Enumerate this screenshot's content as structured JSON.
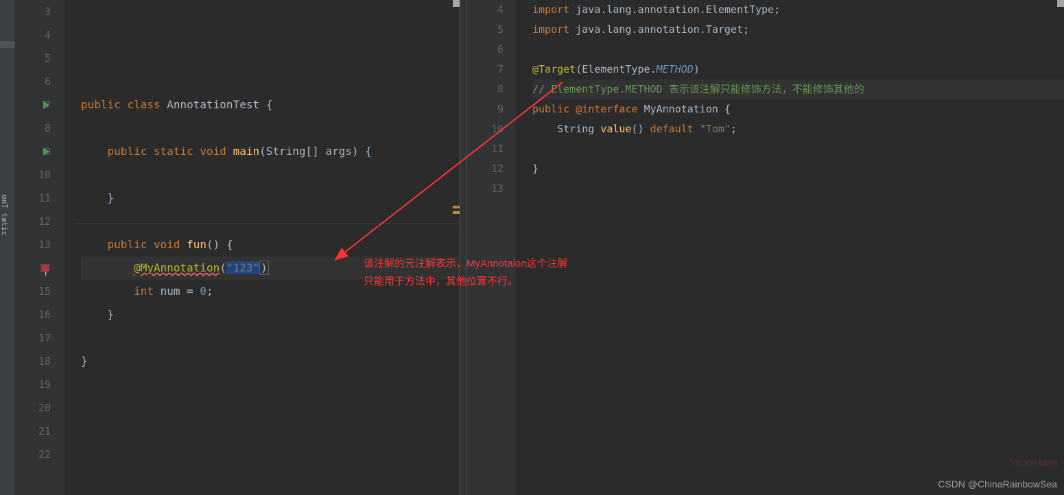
{
  "leftTab": {
    "label": "onT\ntatic"
  },
  "leftPane": {
    "startLine": 3,
    "lines": [
      {
        "n": 3,
        "indent": 0,
        "tokens": []
      },
      {
        "n": 4,
        "indent": 0,
        "tokens": []
      },
      {
        "n": 5,
        "indent": 0,
        "tokens": []
      },
      {
        "n": 6,
        "indent": 0,
        "tokens": []
      },
      {
        "n": 7,
        "indent": 0,
        "run": true,
        "tokens": [
          {
            "t": "public ",
            "c": "kw"
          },
          {
            "t": "class ",
            "c": "kw"
          },
          {
            "t": "AnnotationTest ",
            "c": "cls"
          },
          {
            "t": "{",
            "c": ""
          }
        ]
      },
      {
        "n": 8,
        "indent": 0,
        "tokens": []
      },
      {
        "n": 9,
        "indent": 1,
        "run": true,
        "tokens": [
          {
            "t": "public ",
            "c": "kw"
          },
          {
            "t": "static ",
            "c": "kw"
          },
          {
            "t": "void ",
            "c": "kw"
          },
          {
            "t": "main",
            "c": "method"
          },
          {
            "t": "(",
            "c": ""
          },
          {
            "t": "String",
            "c": "cls"
          },
          {
            "t": "[] ",
            "c": ""
          },
          {
            "t": "args",
            "c": "cls"
          },
          {
            "t": ") {",
            "c": ""
          }
        ]
      },
      {
        "n": 10,
        "indent": 0,
        "tokens": []
      },
      {
        "n": 11,
        "indent": 1,
        "tokens": [
          {
            "t": "}",
            "c": ""
          }
        ]
      },
      {
        "n": 12,
        "indent": 0,
        "tokens": [],
        "sep": true
      },
      {
        "n": 13,
        "indent": 1,
        "tokens": [
          {
            "t": "public ",
            "c": "kw"
          },
          {
            "t": "void ",
            "c": "kw"
          },
          {
            "t": "fun",
            "c": "method"
          },
          {
            "t": "() {",
            "c": ""
          }
        ]
      },
      {
        "n": 14,
        "indent": 2,
        "cursor": true,
        "error": true,
        "tokens": [
          {
            "t": "@MyAnnotation",
            "c": "ann error-underline"
          },
          {
            "t": "(",
            "c": ""
          },
          {
            "t": "\"123\"",
            "c": "str selection"
          },
          {
            "t": ")",
            "c": "caret-border"
          }
        ]
      },
      {
        "n": 15,
        "indent": 2,
        "tokens": [
          {
            "t": "int ",
            "c": "kw"
          },
          {
            "t": "num = ",
            "c": "cls"
          },
          {
            "t": "0",
            "c": "num"
          },
          {
            "t": ";",
            "c": ""
          }
        ]
      },
      {
        "n": 16,
        "indent": 1,
        "tokens": [
          {
            "t": "}",
            "c": ""
          }
        ]
      },
      {
        "n": 17,
        "indent": 0,
        "tokens": []
      },
      {
        "n": 18,
        "indent": 0,
        "tokens": [
          {
            "t": "}",
            "c": ""
          }
        ]
      },
      {
        "n": 19,
        "indent": 0,
        "tokens": []
      },
      {
        "n": 20,
        "indent": 0,
        "tokens": []
      },
      {
        "n": 21,
        "indent": 0,
        "tokens": []
      },
      {
        "n": 22,
        "indent": 0,
        "tokens": []
      }
    ]
  },
  "rightPane": {
    "lines": [
      {
        "n": 4,
        "indent": 0,
        "tokens": [
          {
            "t": "import ",
            "c": "kw"
          },
          {
            "t": "java.lang.annotation.ElementType;",
            "c": "cls"
          }
        ]
      },
      {
        "n": 5,
        "indent": 0,
        "tokens": [
          {
            "t": "import ",
            "c": "kw"
          },
          {
            "t": "java.lang.annotation.Target;",
            "c": "cls"
          }
        ]
      },
      {
        "n": 6,
        "indent": 0,
        "tokens": []
      },
      {
        "n": 7,
        "indent": 0,
        "tokens": [
          {
            "t": "@Target",
            "c": "ann"
          },
          {
            "t": "(",
            "c": ""
          },
          {
            "t": "ElementType",
            "c": "cls"
          },
          {
            "t": ".",
            "c": ""
          },
          {
            "t": "METHOD",
            "c": "num",
            "italic": true
          },
          {
            "t": ")",
            "c": ""
          }
        ]
      },
      {
        "n": 8,
        "indent": 0,
        "cursor": true,
        "tokens": [
          {
            "t": "// ",
            "c": "comment"
          },
          {
            "t": "ElementType.METHOD ",
            "c": "comment-green"
          },
          {
            "t": "表示该注解只能修饰方法，不能修饰其他的",
            "c": "comment-green"
          }
        ]
      },
      {
        "n": 9,
        "indent": 0,
        "tokens": [
          {
            "t": "public ",
            "c": "kw"
          },
          {
            "t": "@interface ",
            "c": "kw"
          },
          {
            "t": "MyAnnotation ",
            "c": "cls"
          },
          {
            "t": "{",
            "c": ""
          }
        ]
      },
      {
        "n": 10,
        "indent": 1,
        "tokens": [
          {
            "t": "String ",
            "c": "cls"
          },
          {
            "t": "value",
            "c": "method"
          },
          {
            "t": "() ",
            "c": ""
          },
          {
            "t": "default ",
            "c": "kw"
          },
          {
            "t": "\"Tom\"",
            "c": "str"
          },
          {
            "t": ";",
            "c": ""
          }
        ]
      },
      {
        "n": 11,
        "indent": 0,
        "tokens": []
      },
      {
        "n": 12,
        "indent": 0,
        "tokens": [
          {
            "t": "}",
            "c": ""
          }
        ]
      },
      {
        "n": 13,
        "indent": 0,
        "tokens": []
      }
    ]
  },
  "annotation": {
    "line1": "该注解的元注解表示，MyAnnotaion这个注解",
    "line2": "只能用于方法中，其他位置不行。"
  },
  "watermarks": {
    "yuucn": "Yuucn.com",
    "csdn": "CSDN @ChinaRainbowSea"
  }
}
